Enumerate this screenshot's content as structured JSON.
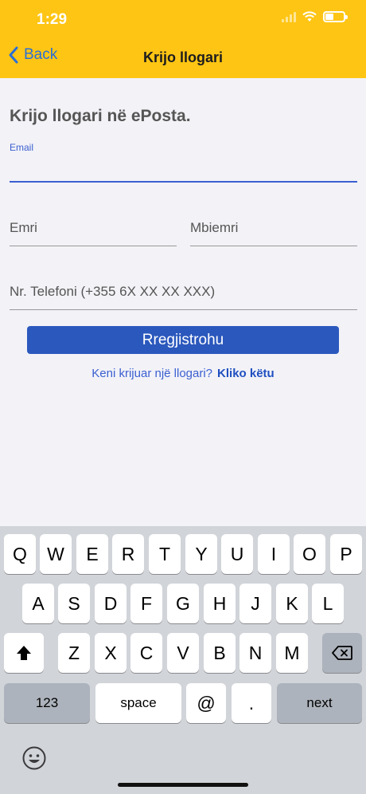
{
  "status_bar": {
    "time": "1:29"
  },
  "nav": {
    "back_label": "Back",
    "title": "Krijo llogari"
  },
  "form": {
    "heading": "Krijo llogari në ePosta.",
    "email_label": "Email",
    "first_name_placeholder": "Emri",
    "last_name_placeholder": "Mbiemri",
    "phone_placeholder": "Nr. Telefoni (+355 6X XX XX XXX)",
    "register_label": "Rregjistrohu",
    "login_prompt": "Keni krijuar një llogari?",
    "login_link": "Kliko këtu"
  },
  "keyboard": {
    "row1": [
      "Q",
      "W",
      "E",
      "R",
      "T",
      "Y",
      "U",
      "I",
      "O",
      "P"
    ],
    "row2": [
      "A",
      "S",
      "D",
      "F",
      "G",
      "H",
      "J",
      "K",
      "L"
    ],
    "row3": [
      "Z",
      "X",
      "C",
      "V",
      "B",
      "N",
      "M"
    ],
    "numbers_label": "123",
    "space_label": "space",
    "at_label": "@",
    "dot_label": ".",
    "next_label": "next"
  },
  "colors": {
    "accent": "#fec514",
    "primary": "#2b58bd",
    "link": "#3b5fd0"
  }
}
